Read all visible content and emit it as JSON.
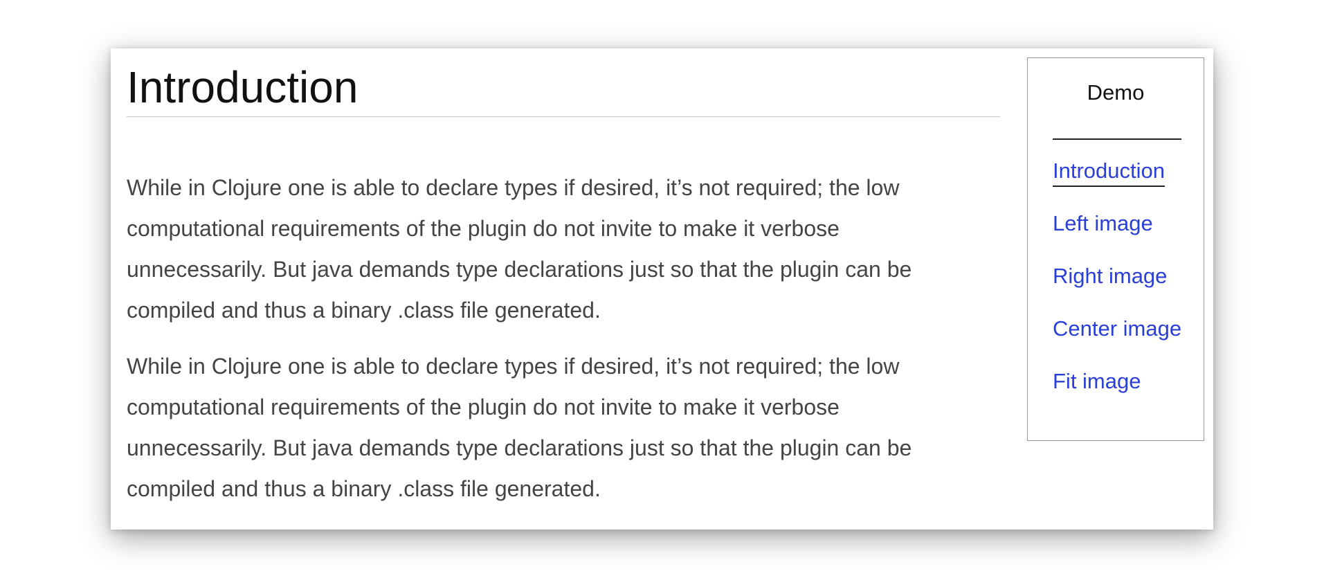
{
  "article": {
    "title": "Introduction",
    "paragraphs": [
      "While in Clojure one is able to declare types if desired, it’s not required; the low computational requirements of the plugin do not invite to make it verbose unnecessarily. But java demands type declarations just so that the plugin can be compiled and thus a binary .class file generated.",
      "While in Clojure one is able to declare types if desired, it’s not required; the low computational requirements of the plugin do not invite to make it verbose unnecessarily. But java demands type declarations just so that the plugin can be compiled and thus a binary .class file generated."
    ]
  },
  "toc": {
    "title": "Demo",
    "items": [
      {
        "label": "Introduction",
        "active": true
      },
      {
        "label": "Left image",
        "active": false
      },
      {
        "label": "Right image",
        "active": false
      },
      {
        "label": "Center image",
        "active": false
      },
      {
        "label": "Fit image",
        "active": false
      }
    ]
  },
  "colors": {
    "link": "#2a3fd6",
    "body_text": "#444444",
    "heading": "#111111"
  }
}
